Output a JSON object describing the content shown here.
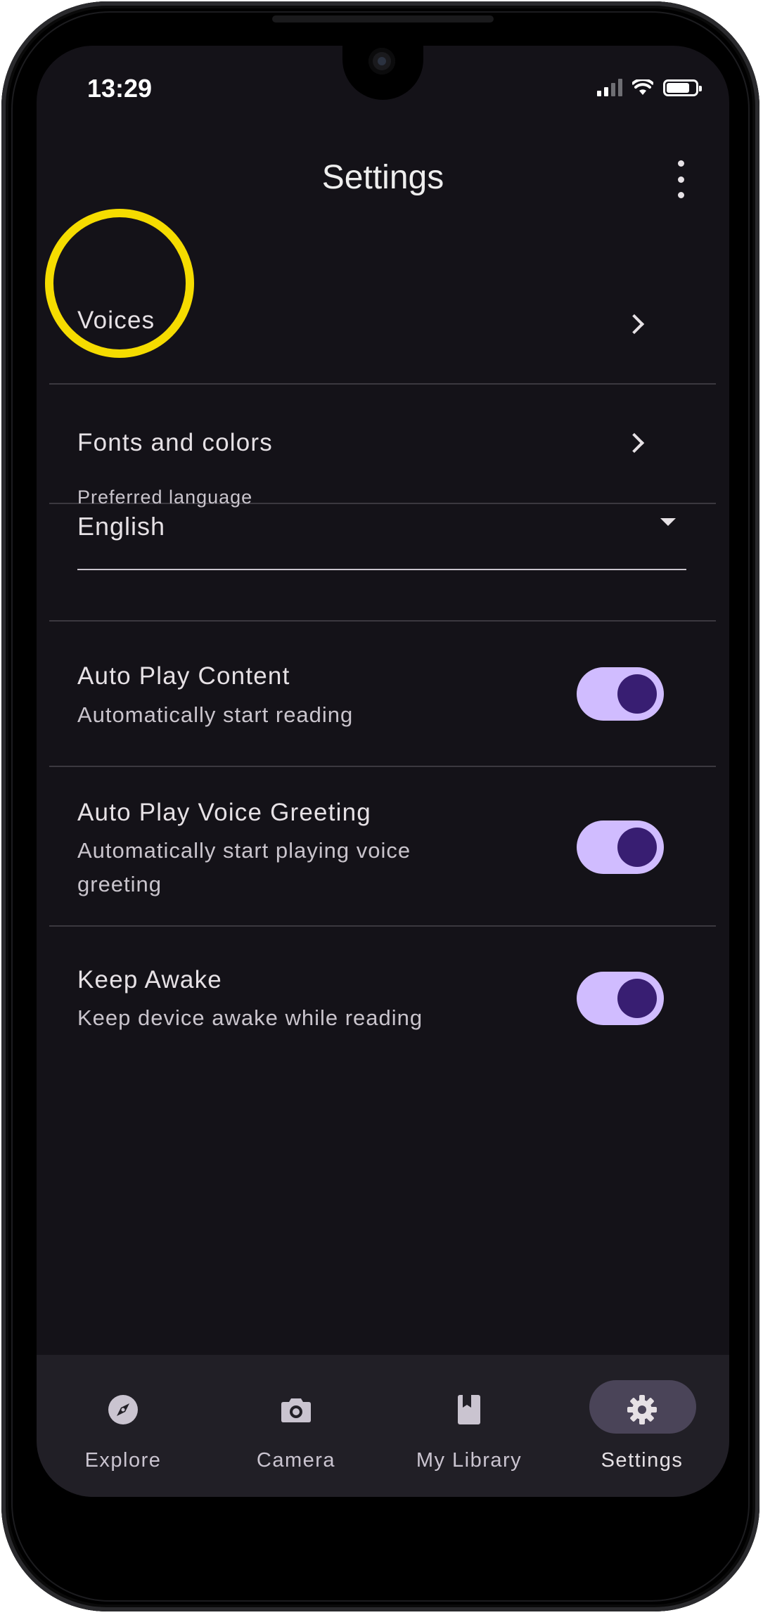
{
  "status_bar": {
    "time": "13:29"
  },
  "header": {
    "title": "Settings",
    "menu_icon": "more-vert-icon"
  },
  "settings": {
    "voices": {
      "label": "Voices"
    },
    "fonts": {
      "label": "Fonts and colors"
    },
    "language": {
      "label": "Preferred language",
      "value": "English"
    },
    "auto_play_content": {
      "label": "Auto Play Content",
      "description": "Automatically start reading",
      "enabled": true
    },
    "auto_play_voice": {
      "label": "Auto Play Voice Greeting",
      "description": "Automatically start playing voice greeting",
      "enabled": true
    },
    "keep_awake": {
      "label": "Keep Awake",
      "description": "Keep device awake while reading",
      "enabled": true
    }
  },
  "nav": {
    "explore": {
      "label": "Explore",
      "icon": "compass-icon"
    },
    "camera": {
      "label": "Camera",
      "icon": "camera-icon"
    },
    "library": {
      "label": "My Library",
      "icon": "book-icon"
    },
    "settings": {
      "label": "Settings",
      "icon": "gear-icon",
      "active": true
    }
  },
  "colors": {
    "background": "#141218",
    "toggle_track": "#d0bcff",
    "toggle_knob": "#381e72",
    "highlight": "#f5dc00",
    "nav_active": "#4a4458"
  }
}
